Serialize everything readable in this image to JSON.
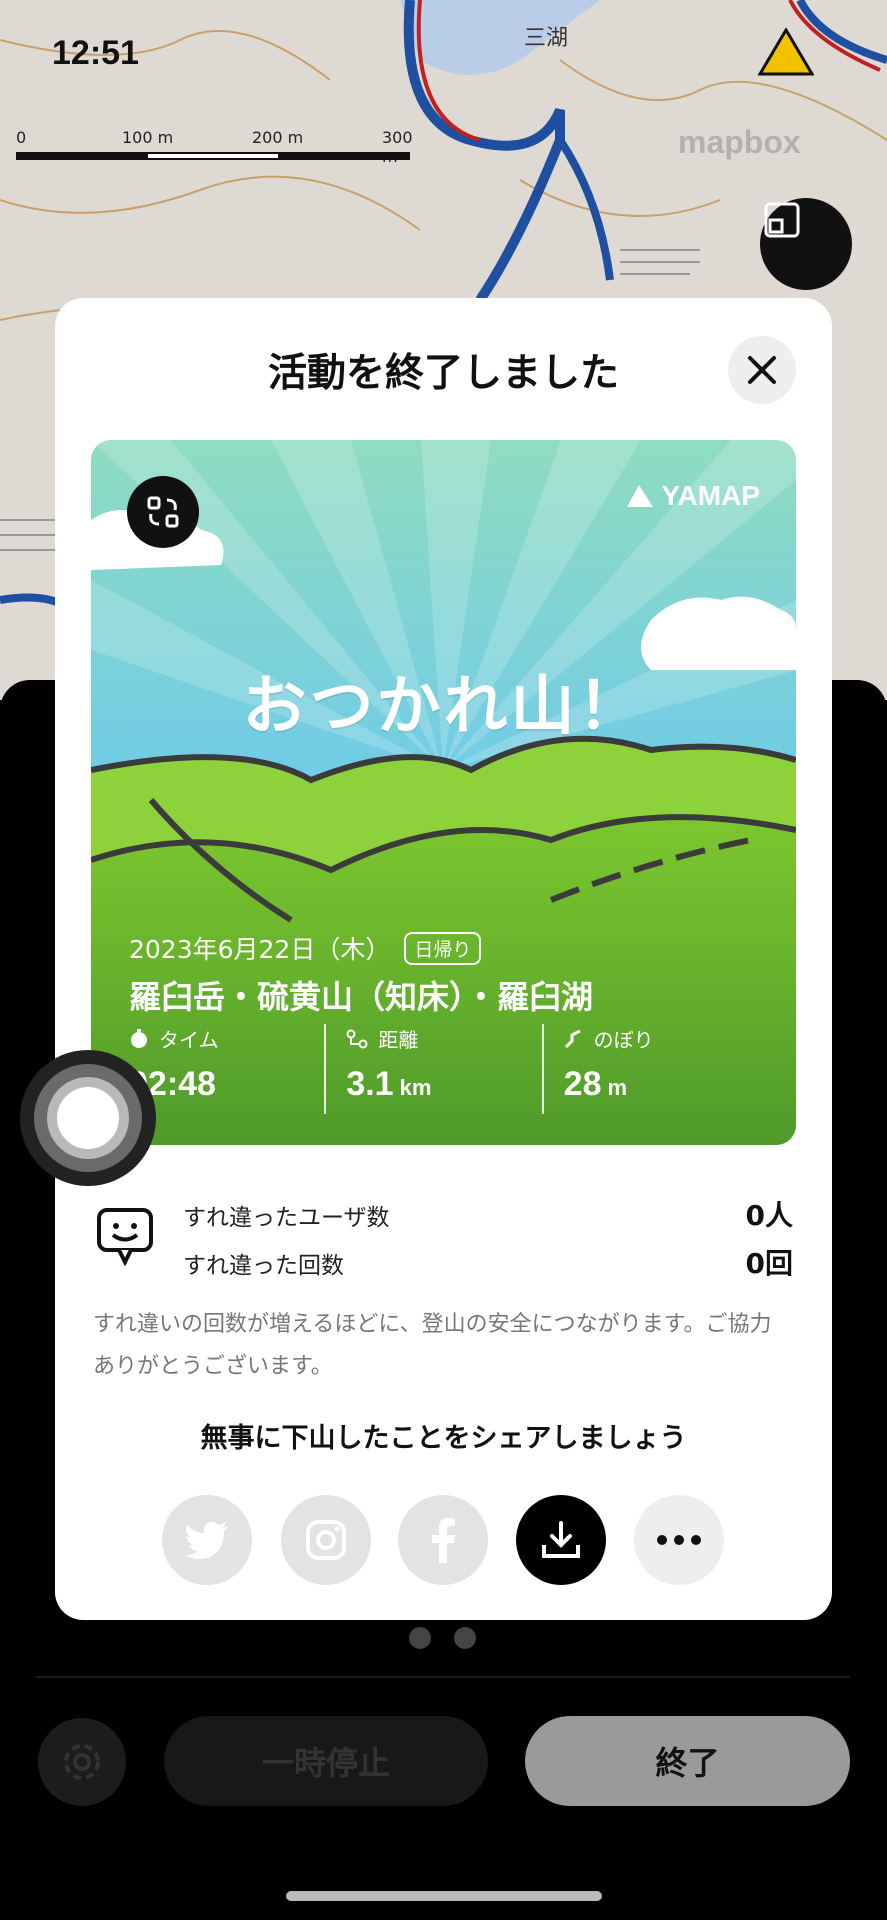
{
  "status_bar": {
    "time": "12:51"
  },
  "map": {
    "place_label": "三湖",
    "scale": {
      "labels": [
        "0",
        "100 m",
        "200 m",
        "300 m"
      ]
    },
    "attribution": "mapbox"
  },
  "modal": {
    "title": "活動を終了しました",
    "card": {
      "brand": "YAMAP",
      "headline": "おつかれ山！",
      "date": "2023年6月22日（木）",
      "trip_type": "日帰り",
      "route": "羅臼岳・硫黄山（知床）・羅臼湖",
      "stats": [
        {
          "label": "タイム",
          "value": "02:48",
          "unit": "",
          "icon": "timer-icon"
        },
        {
          "label": "距離",
          "value": "3.1",
          "unit": "km",
          "icon": "route-icon"
        },
        {
          "label": "のぼり",
          "value": "28",
          "unit": "m",
          "icon": "ascent-icon"
        }
      ]
    },
    "passes": {
      "users_label": "すれ違ったユーザ数",
      "users_value": "0人",
      "count_label": "すれ違った回数",
      "count_value": "0回"
    },
    "note": "すれ違いの回数が増えるほどに、登山の安全につながります。ご協力ありがとうございます。",
    "share_title": "無事に下山したことをシェアしましょう",
    "share_buttons": [
      "twitter-icon",
      "instagram-icon",
      "facebook-icon",
      "download-icon",
      "more-icon"
    ]
  },
  "bottom_bar": {
    "pause_label": "一時停止",
    "end_label": "終了"
  },
  "colors": {
    "accent": "#111111",
    "card_green": "#6db82e",
    "sky": "#5cc6e8"
  }
}
